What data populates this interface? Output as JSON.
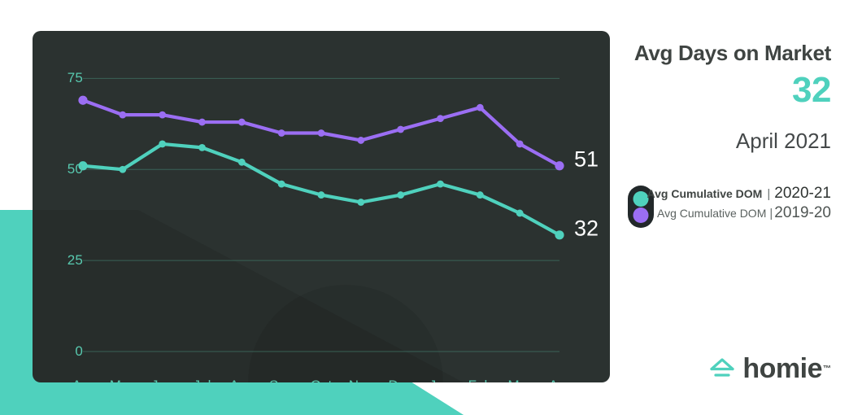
{
  "panel": {
    "title": "Avg Days on Market",
    "value": "32",
    "date": "April 2021",
    "logo_text": "homie",
    "logo_tm": "™"
  },
  "legend": {
    "items": [
      {
        "name": "Avg Cumulative DOM",
        "separator": "|",
        "year": "2020-21",
        "color": "#4fd1bd"
      },
      {
        "name": "Avg Cumulative DOM",
        "separator": "|",
        "year": "2019-20",
        "color": "#9b6ef3"
      }
    ]
  },
  "end_labels": {
    "series_2019_20": "51",
    "series_2020_21": "32"
  },
  "colors": {
    "teal": "#4fd1bd",
    "purple": "#9b6ef3",
    "card_bg": "#2b3230",
    "axis_text": "#58c9af",
    "grid": "#3f6f62",
    "blob": "#4fd1bd",
    "page_bg": "#ffffff",
    "title_text": "#3f4442"
  },
  "chart_data": {
    "type": "line",
    "title": "Avg Days on Market",
    "xlabel": "",
    "ylabel": "",
    "ylim": [
      0,
      80
    ],
    "yticks": [
      0,
      25,
      50,
      75
    ],
    "ytick_labels": [
      "0",
      "25",
      "50",
      "75"
    ],
    "grid": true,
    "legend_position": "right",
    "categories": [
      "Apr",
      "May",
      "Jun",
      "Jul",
      "Aug",
      "Sep",
      "Oct",
      "Nov",
      "Dec",
      "Jan",
      "Feb",
      "Mar",
      "Apr"
    ],
    "series": [
      {
        "name": "Avg Cumulative DOM 2020-21",
        "color": "#4fd1bd",
        "end_label": "32",
        "values": [
          51,
          50,
          57,
          56,
          52,
          46,
          43,
          41,
          43,
          46,
          43,
          38,
          32
        ]
      },
      {
        "name": "Avg Cumulative DOM 2019-20",
        "color": "#9b6ef3",
        "end_label": "51",
        "values": [
          69,
          65,
          65,
          63,
          63,
          60,
          60,
          58,
          61,
          64,
          67,
          57,
          51
        ]
      }
    ]
  }
}
